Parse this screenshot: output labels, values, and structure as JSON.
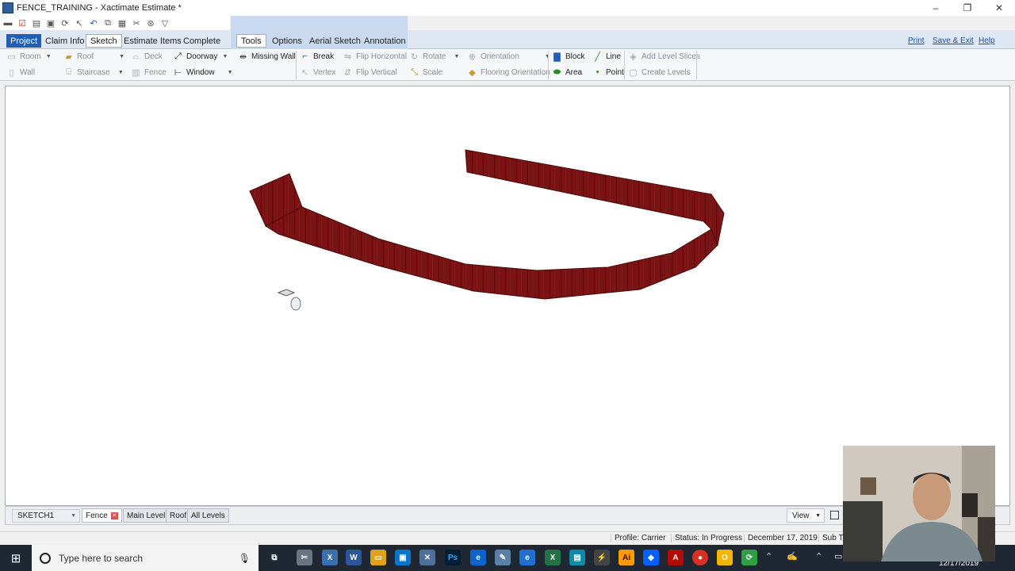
{
  "window": {
    "title": "FENCE_TRAINING - Xactimate Estimate *",
    "controls": {
      "minimize": "–",
      "restore": "❐",
      "close": "✕"
    }
  },
  "menu_tabs": [
    "Project",
    "Claim Info",
    "Sketch",
    "Estimate Items",
    "Complete"
  ],
  "sub_tabs": [
    "Tools",
    "Options",
    "Aerial Sketch",
    "Annotation"
  ],
  "top_links": {
    "print": "Print",
    "save_exit": "Save & Exit",
    "help": "Help"
  },
  "ribbon": {
    "room": "Room",
    "roof": "Roof",
    "deck": "Deck",
    "doorway": "Doorway",
    "missing_wall": "Missing Wall",
    "wall": "Wall",
    "staircase": "Staircase",
    "fence": "Fence",
    "window": "Window",
    "break": "Break",
    "flip_horizontal": "Flip Horizontal",
    "rotate": "Rotate",
    "orientation": "Orientation",
    "vertex": "Vertex",
    "flip_vertical": "Flip Vertical",
    "scale": "Scale",
    "flooring_orientation": "Flooring Orientation",
    "block": "Block",
    "line": "Line",
    "area": "Area",
    "point": "Point",
    "add_level_slices": "Add Level Slices",
    "create_levels": "Create Levels"
  },
  "bottom": {
    "sketch_select": "SKETCH1",
    "tabs": [
      "Fence",
      "Main Level",
      "Roof",
      "All Levels"
    ],
    "view": "View"
  },
  "status": {
    "profile": "Profile: Carrier",
    "status": "Status: In Progress",
    "date": "December 17, 2019",
    "sub": "Sub T"
  },
  "taskbar": {
    "search_placeholder": "Type here to search",
    "clock_date": "12/17/2019"
  },
  "colors": {
    "accent": "#1f5fb5",
    "fence": "#7a1212",
    "taskbar": "#1f2733"
  }
}
